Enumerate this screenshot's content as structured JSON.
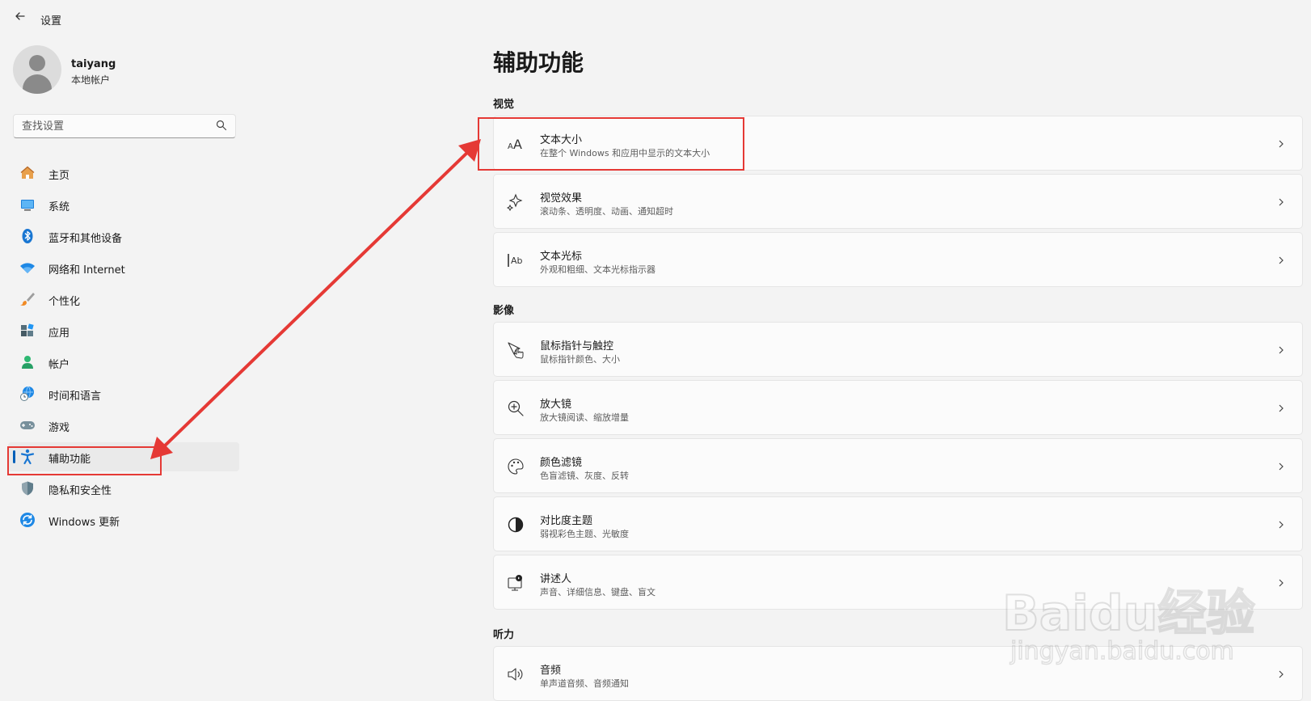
{
  "titlebar": {
    "back_icon": "back-arrow-icon",
    "title": "设置"
  },
  "profile": {
    "name": "taiyang",
    "account_type": "本地帐户",
    "avatar_icon": "user-avatar-icon"
  },
  "search": {
    "placeholder": "查找设置",
    "value": "",
    "icon": "search-icon"
  },
  "nav": {
    "items": [
      {
        "label": "主页",
        "icon": "home-icon",
        "selected": false
      },
      {
        "label": "系统",
        "icon": "system-display-icon",
        "selected": false
      },
      {
        "label": "蓝牙和其他设备",
        "icon": "bluetooth-icon",
        "selected": false
      },
      {
        "label": "网络和 Internet",
        "icon": "wifi-icon",
        "selected": false
      },
      {
        "label": "个性化",
        "icon": "paintbrush-icon",
        "selected": false
      },
      {
        "label": "应用",
        "icon": "apps-icon",
        "selected": false
      },
      {
        "label": "帐户",
        "icon": "account-icon",
        "selected": false
      },
      {
        "label": "时间和语言",
        "icon": "globe-clock-icon",
        "selected": false
      },
      {
        "label": "游戏",
        "icon": "gamepad-icon",
        "selected": false
      },
      {
        "label": "辅助功能",
        "icon": "accessibility-icon",
        "selected": true
      },
      {
        "label": "隐私和安全性",
        "icon": "shield-icon",
        "selected": false
      },
      {
        "label": "Windows 更新",
        "icon": "update-icon",
        "selected": false
      }
    ]
  },
  "main": {
    "title": "辅助功能",
    "sections": [
      {
        "header": "视觉",
        "cards": [
          {
            "title": "文本大小",
            "subtitle": "在整个 Windows 和应用中显示的文本大小",
            "icon": "text-size-icon"
          },
          {
            "title": "视觉效果",
            "subtitle": "滚动条、透明度、动画、通知超时",
            "icon": "sparkle-icon"
          },
          {
            "title": "文本光标",
            "subtitle": "外观和粗细、文本光标指示器",
            "icon": "text-cursor-icon"
          }
        ]
      },
      {
        "header": "影像",
        "cards": [
          {
            "title": "鼠标指针与触控",
            "subtitle": "鼠标指针颜色、大小",
            "icon": "pointer-touch-icon"
          },
          {
            "title": "放大镜",
            "subtitle": "放大镜阅读、缩放增量",
            "icon": "magnifier-icon"
          },
          {
            "title": "颜色滤镜",
            "subtitle": "色盲滤镜、灰度、反转",
            "icon": "palette-icon"
          },
          {
            "title": "对比度主题",
            "subtitle": "弱视彩色主题、光敏度",
            "icon": "contrast-icon"
          },
          {
            "title": "讲述人",
            "subtitle": "声音、详细信息、键盘、盲文",
            "icon": "narrator-icon"
          }
        ]
      },
      {
        "header": "听力",
        "cards": [
          {
            "title": "音频",
            "subtitle": "单声道音频、音频通知",
            "icon": "speaker-icon"
          }
        ]
      }
    ]
  },
  "annotations": {
    "color": "#e53935",
    "highlight_targets": [
      "文本大小",
      "辅助功能"
    ]
  },
  "watermark": {
    "text": "Baidu经验",
    "url_text": "jingyan.baidu.com"
  },
  "colors": {
    "accent": "#005fb8",
    "background": "#f3f3f3",
    "card": "#fbfbfb"
  }
}
